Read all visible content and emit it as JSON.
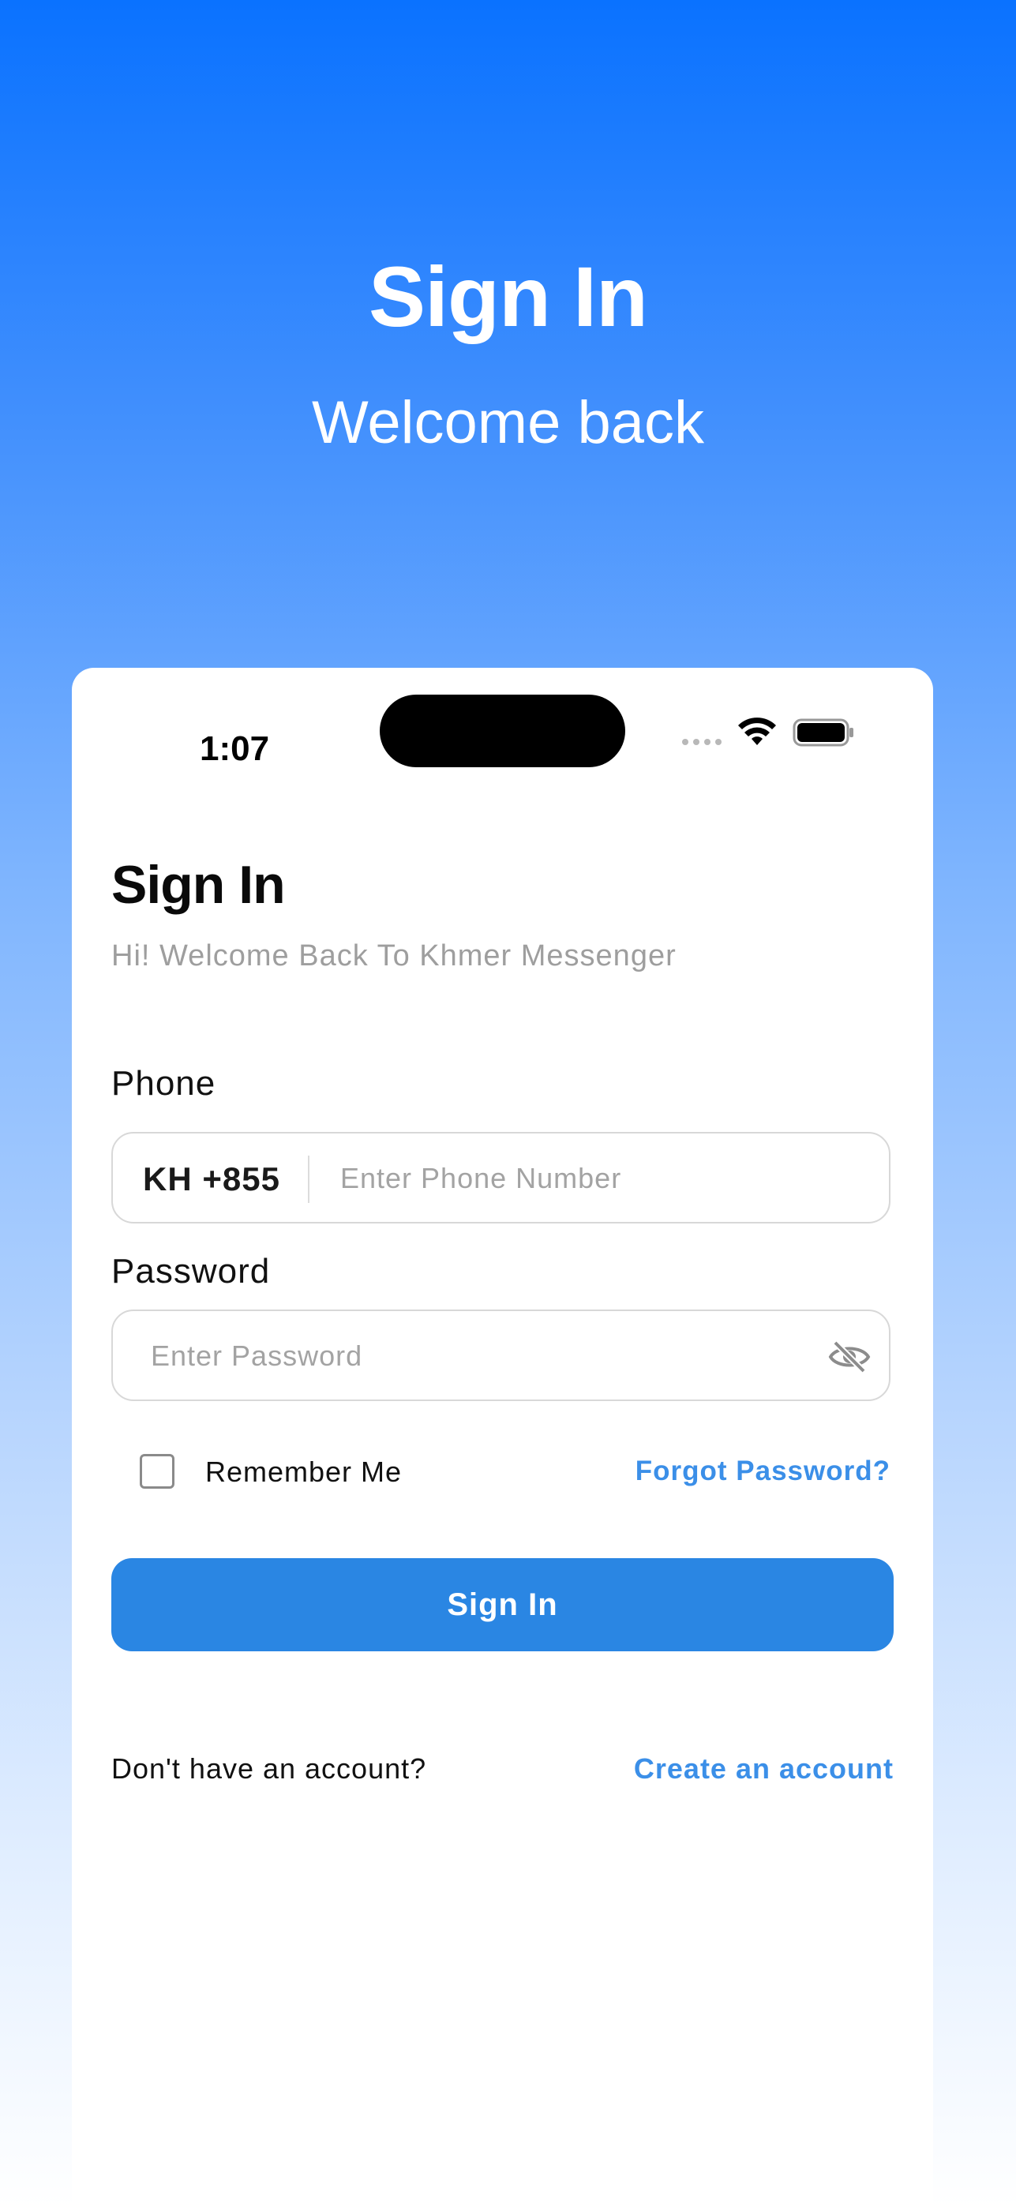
{
  "hero": {
    "title": "Sign In",
    "subtitle": "Welcome back"
  },
  "status_bar": {
    "time": "1:07",
    "icons": [
      "cellular-signal-icon",
      "wifi-icon",
      "battery-icon"
    ]
  },
  "screen": {
    "title": "Sign In",
    "subtitle": "Hi! Welcome Back To Khmer Messenger"
  },
  "phone": {
    "label": "Phone",
    "country_code": "KH +855",
    "placeholder": "Enter Phone Number"
  },
  "password": {
    "label": "Password",
    "placeholder": "Enter Password",
    "icon": "eye-off-icon"
  },
  "options": {
    "remember_label": "Remember Me",
    "remember_checked": false,
    "forgot_label": "Forgot Password?"
  },
  "actions": {
    "signin_label": "Sign In"
  },
  "footer": {
    "prompt": "Don't have an account?",
    "create_label": "Create an account"
  },
  "colors": {
    "accent": "#2a86e3",
    "link": "#3b8fe8",
    "gradient_top": "#0a72ff",
    "gradient_bottom": "#ffffff"
  }
}
